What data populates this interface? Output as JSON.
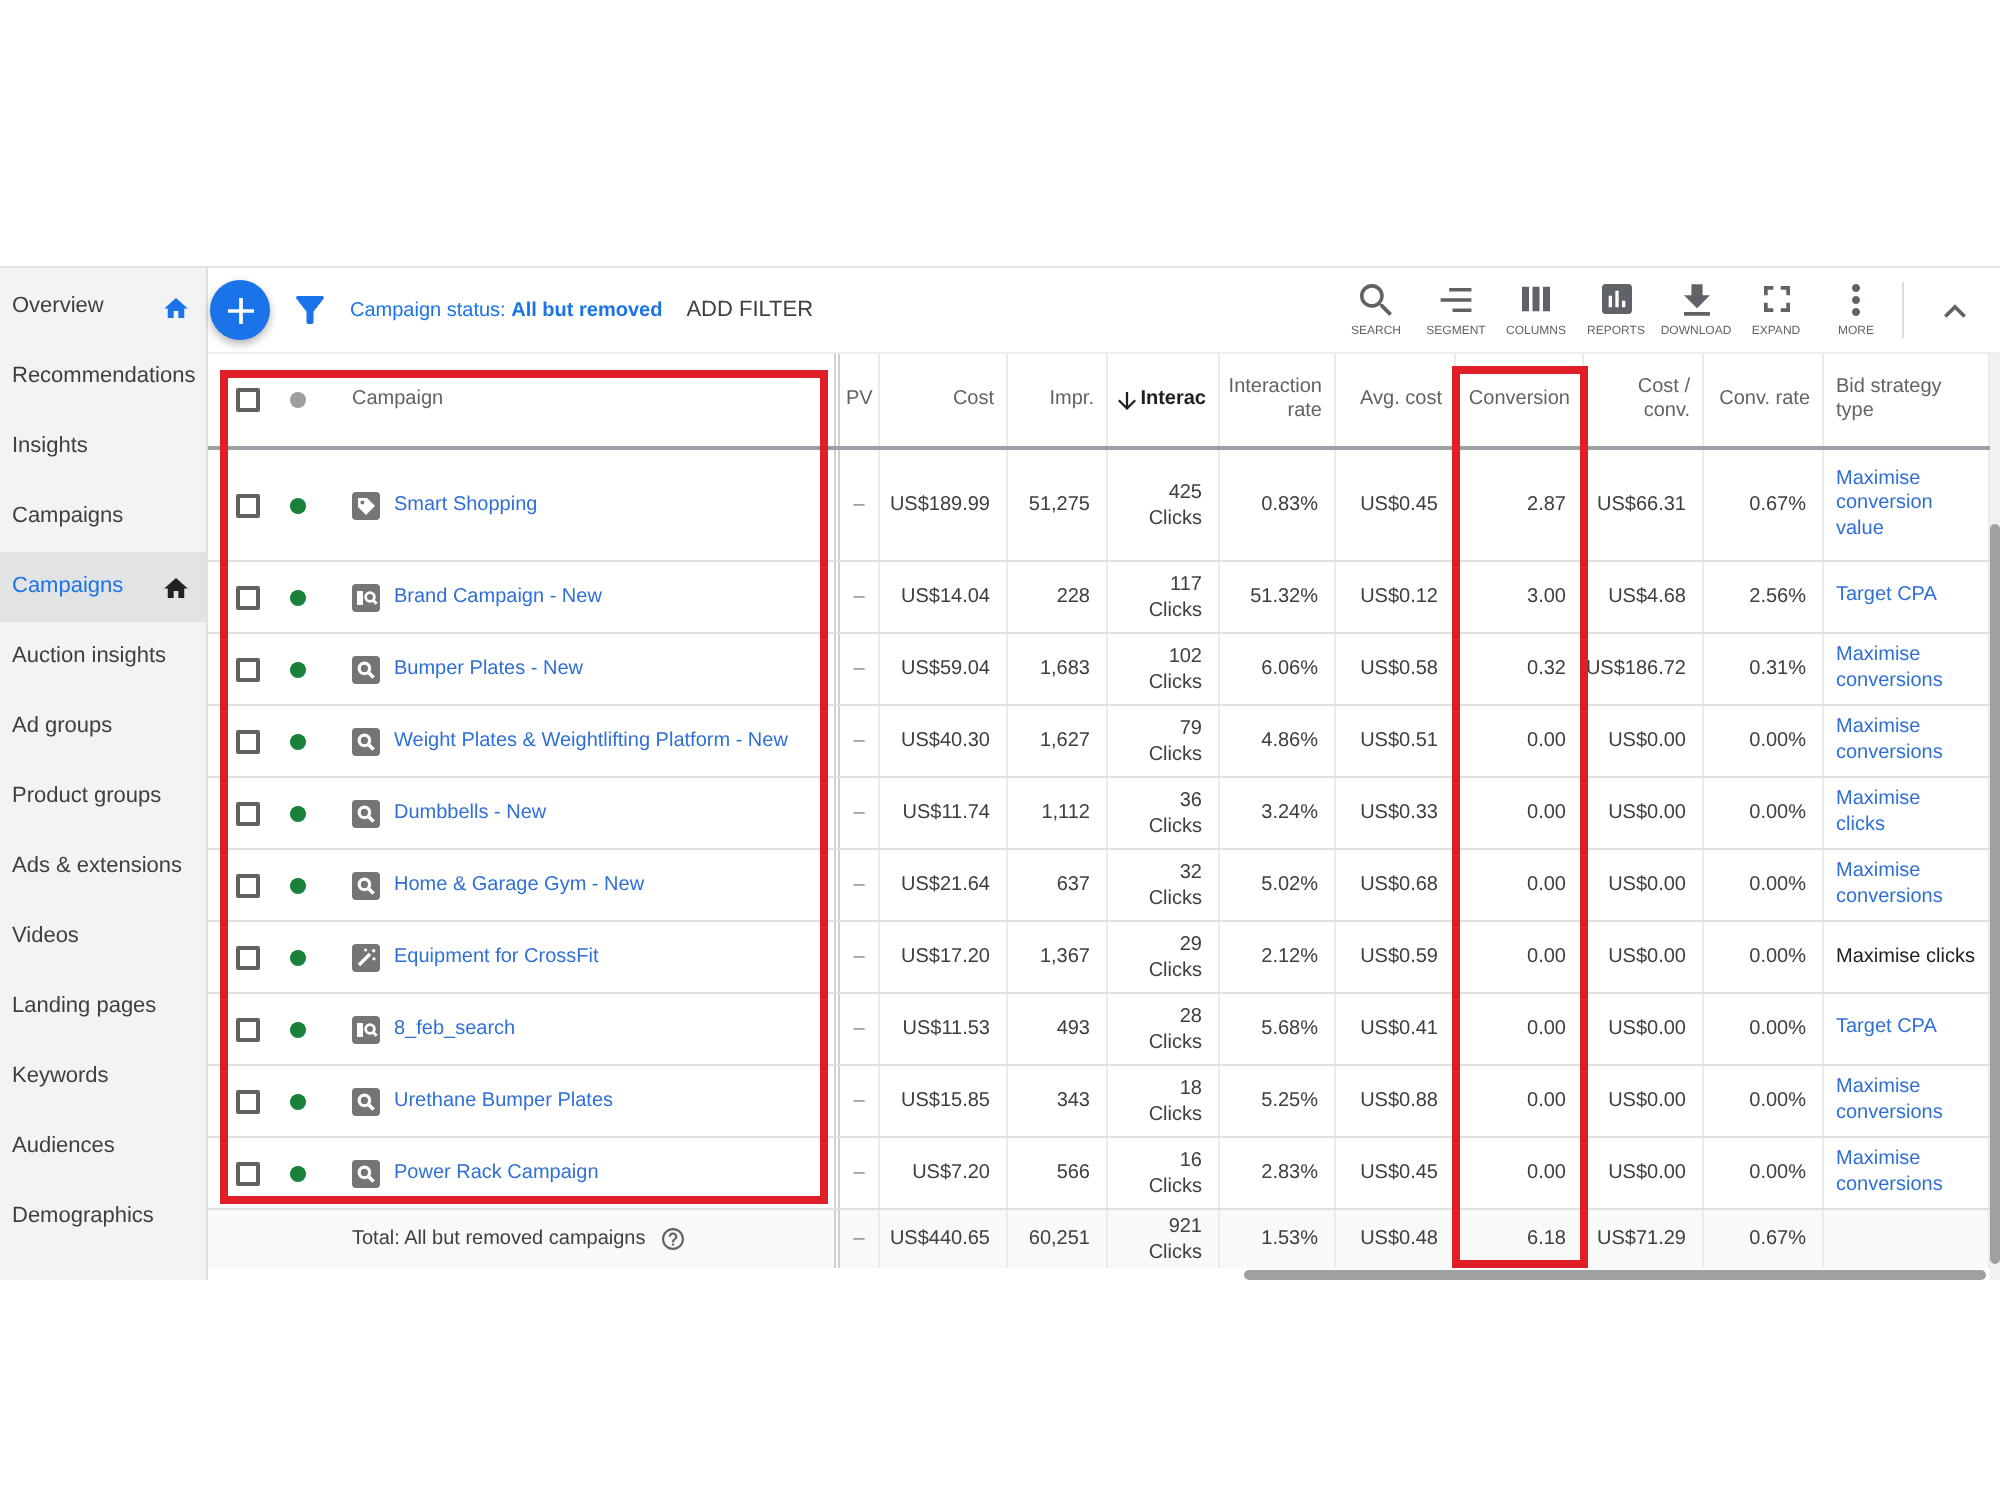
{
  "sidebar": {
    "items": [
      {
        "label": "Overview",
        "selected": false,
        "home": true
      },
      {
        "label": "Recommendations",
        "selected": false,
        "home": false
      },
      {
        "label": "Insights",
        "selected": false,
        "home": false
      },
      {
        "label": "Campaigns",
        "selected": false,
        "home": false
      },
      {
        "label": "Campaigns",
        "selected": true,
        "home": true
      },
      {
        "label": "Auction insights",
        "selected": false,
        "home": false
      },
      {
        "label": "Ad groups",
        "selected": false,
        "home": false
      },
      {
        "label": "Product groups",
        "selected": false,
        "home": false
      },
      {
        "label": "Ads & extensions",
        "selected": false,
        "home": false
      },
      {
        "label": "Videos",
        "selected": false,
        "home": false
      },
      {
        "label": "Landing pages",
        "selected": false,
        "home": false
      },
      {
        "label": "Keywords",
        "selected": false,
        "home": false
      },
      {
        "label": "Audiences",
        "selected": false,
        "home": false
      },
      {
        "label": "Demographics",
        "selected": false,
        "home": false
      }
    ]
  },
  "toolbar": {
    "filter": "Campaign status: **All but removed**",
    "add_filter": "ADD FILTER",
    "tools": [
      {
        "kind": "search",
        "label": "SEARCH"
      },
      {
        "kind": "segment",
        "label": "SEGMENT"
      },
      {
        "kind": "columns",
        "label": "COLUMNS"
      },
      {
        "kind": "reports",
        "label": "REPORTS"
      },
      {
        "kind": "download",
        "label": "DOWNLOAD"
      },
      {
        "kind": "expand",
        "label": "EXPAND"
      },
      {
        "kind": "more",
        "label": "MORE"
      }
    ]
  },
  "table": {
    "select_all": {
      "checked": false
    },
    "columns": [
      {
        "label": "Campaign",
        "sorted": false,
        "highlighted": true
      },
      {
        "label": "PV",
        "sorted": false,
        "highlighted": false
      },
      {
        "label": "Cost",
        "sorted": false,
        "highlighted": false
      },
      {
        "label": "Impr.",
        "sorted": false,
        "highlighted": false
      },
      {
        "label": "Interac",
        "sorted": true,
        "highlighted": false
      },
      {
        "label": "Interaction rate",
        "sorted": false,
        "highlighted": false
      },
      {
        "label": "Avg. cost",
        "sorted": false,
        "highlighted": false
      },
      {
        "label": "Conversion",
        "sorted": false,
        "highlighted": true
      },
      {
        "label": "Cost / conv.",
        "sorted": false,
        "highlighted": false
      },
      {
        "label": "Conv. rate",
        "sorted": false,
        "highlighted": false
      },
      {
        "label": "Bid strategy type",
        "sorted": false,
        "highlighted": false
      }
    ],
    "rows": [
      {
        "name": "Smart Shopping",
        "kind": "shopping",
        "color": "#188038",
        "checked": false,
        "pv": "–",
        "cost": "US$189.99",
        "impr": "51,275",
        "interactions": {
          "value": "425",
          "unit": "Clicks"
        },
        "interaction_rate": "0.83%",
        "avg_cost": "US$0.45",
        "conversions": "2.87",
        "cost_per_conv": "US$66.31",
        "conv_rate": "0.67%",
        "bid_strategy": {
          "text": "Maximise conversion value",
          "link": true
        }
      },
      {
        "name": "Brand Campaign - New",
        "kind": "dynamic",
        "color": "#188038",
        "checked": false,
        "pv": "–",
        "cost": "US$14.04",
        "impr": "228",
        "interactions": {
          "value": "117",
          "unit": "Clicks"
        },
        "interaction_rate": "51.32%",
        "avg_cost": "US$0.12",
        "conversions": "3.00",
        "cost_per_conv": "US$4.68",
        "conv_rate": "2.56%",
        "bid_strategy": {
          "text": "Target CPA",
          "link": true
        }
      },
      {
        "name": "Bumper Plates - New",
        "kind": "search",
        "color": "#188038",
        "checked": false,
        "pv": "–",
        "cost": "US$59.04",
        "impr": "1,683",
        "interactions": {
          "value": "102",
          "unit": "Clicks"
        },
        "interaction_rate": "6.06%",
        "avg_cost": "US$0.58",
        "conversions": "0.32",
        "cost_per_conv": "US$186.72",
        "conv_rate": "0.31%",
        "bid_strategy": {
          "text": "Maximise conversions",
          "link": true
        }
      },
      {
        "name": "Weight Plates & Weightlifting Platform - New",
        "kind": "search",
        "color": "#188038",
        "checked": false,
        "pv": "–",
        "cost": "US$40.30",
        "impr": "1,627",
        "interactions": {
          "value": "79",
          "unit": "Clicks"
        },
        "interaction_rate": "4.86%",
        "avg_cost": "US$0.51",
        "conversions": "0.00",
        "cost_per_conv": "US$0.00",
        "conv_rate": "0.00%",
        "bid_strategy": {
          "text": "Maximise conversions",
          "link": true
        }
      },
      {
        "name": "Dumbbells - New",
        "kind": "search",
        "color": "#188038",
        "checked": false,
        "pv": "–",
        "cost": "US$11.74",
        "impr": "1,112",
        "interactions": {
          "value": "36",
          "unit": "Clicks"
        },
        "interaction_rate": "3.24%",
        "avg_cost": "US$0.33",
        "conversions": "0.00",
        "cost_per_conv": "US$0.00",
        "conv_rate": "0.00%",
        "bid_strategy": {
          "text": "Maximise clicks",
          "link": true
        }
      },
      {
        "name": "Home & Garage Gym - New",
        "kind": "search",
        "color": "#188038",
        "checked": false,
        "pv": "–",
        "cost": "US$21.64",
        "impr": "637",
        "interactions": {
          "value": "32",
          "unit": "Clicks"
        },
        "interaction_rate": "5.02%",
        "avg_cost": "US$0.68",
        "conversions": "0.00",
        "cost_per_conv": "US$0.00",
        "conv_rate": "0.00%",
        "bid_strategy": {
          "text": "Maximise conversions",
          "link": true
        }
      },
      {
        "name": "Equipment for CrossFit",
        "kind": "smart",
        "color": "#188038",
        "checked": false,
        "pv": "–",
        "cost": "US$17.20",
        "impr": "1,367",
        "interactions": {
          "value": "29",
          "unit": "Clicks"
        },
        "interaction_rate": "2.12%",
        "avg_cost": "US$0.59",
        "conversions": "0.00",
        "cost_per_conv": "US$0.00",
        "conv_rate": "0.00%",
        "bid_strategy": {
          "text": "Maximise clicks",
          "link": false
        }
      },
      {
        "name": "8_feb_search",
        "kind": "dynamic",
        "color": "#188038",
        "checked": false,
        "pv": "–",
        "cost": "US$11.53",
        "impr": "493",
        "interactions": {
          "value": "28",
          "unit": "Clicks"
        },
        "interaction_rate": "5.68%",
        "avg_cost": "US$0.41",
        "conversions": "0.00",
        "cost_per_conv": "US$0.00",
        "conv_rate": "0.00%",
        "bid_strategy": {
          "text": "Target CPA",
          "link": true
        }
      },
      {
        "name": "Urethane Bumper Plates",
        "kind": "search",
        "color": "#188038",
        "checked": false,
        "pv": "–",
        "cost": "US$15.85",
        "impr": "343",
        "interactions": {
          "value": "18",
          "unit": "Clicks"
        },
        "interaction_rate": "5.25%",
        "avg_cost": "US$0.88",
        "conversions": "0.00",
        "cost_per_conv": "US$0.00",
        "conv_rate": "0.00%",
        "bid_strategy": {
          "text": "Maximise conversions",
          "link": true
        }
      },
      {
        "name": "Power Rack Campaign",
        "kind": "search",
        "color": "#188038",
        "checked": false,
        "pv": "–",
        "cost": "US$7.20",
        "impr": "566",
        "interactions": {
          "value": "16",
          "unit": "Clicks"
        },
        "interaction_rate": "2.83%",
        "avg_cost": "US$0.45",
        "conversions": "0.00",
        "cost_per_conv": "US$0.00",
        "conv_rate": "0.00%",
        "bid_strategy": {
          "text": "Maximise conversions",
          "link": true
        }
      }
    ],
    "total": {
      "label": "Total: All but removed campaigns",
      "pv": "–",
      "cost": "US$440.65",
      "impr": "60,251",
      "interactions": {
        "value": "921",
        "unit": "Clicks"
      },
      "interaction_rate": "1.53%",
      "avg_cost": "US$0.48",
      "conversions": "6.18",
      "cost_per_conv": "US$71.29",
      "conv_rate": "0.67%"
    }
  }
}
